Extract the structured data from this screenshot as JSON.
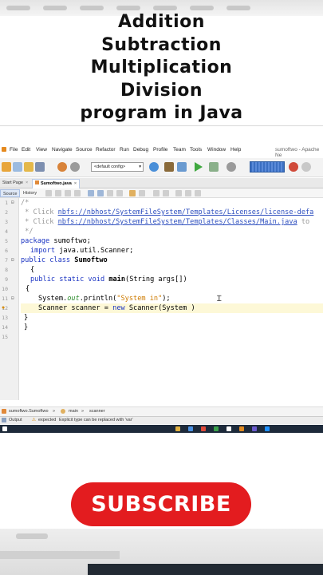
{
  "heading": {
    "lines": [
      "Addition",
      "Subtraction",
      "Multiplication",
      "Division",
      "program in Java"
    ]
  },
  "ide": {
    "window_title": "sumoftwo - Apache Ne",
    "menu": [
      "File",
      "Edit",
      "View",
      "Navigate",
      "Source",
      "Refactor",
      "Run",
      "Debug",
      "Profile",
      "Team",
      "Tools",
      "Window",
      "Help"
    ],
    "config_select": "<default config>",
    "tabs": {
      "start_page": "Start Page",
      "file": "Sumoftwo.java"
    },
    "editor_tabs": {
      "source": "Source",
      "history": "History"
    },
    "line_numbers": [
      "1",
      "2",
      "3",
      "4",
      "5",
      "6",
      "7",
      "8",
      "9",
      "10",
      "11",
      "12",
      "13",
      "14",
      "15"
    ],
    "code": {
      "l1": "/*",
      "l2_prefix": " * Click ",
      "l2_link": "nbfs://nbhost/SystemFileSystem/Templates/Licenses/license-defa",
      "l3_prefix": " * Click ",
      "l3_link": "nbfs://nbhost/SystemFileSystem/Templates/Classes/Main.java",
      "l3_suffix": " to",
      "l4": " */",
      "l5_kw": "package",
      "l5_rest": " sumoftwo;",
      "l6_kw": "import",
      "l6_rest": " java.util.Scanner;",
      "l7_kw": "public class",
      "l7_name": "Sumoftwo",
      "l8": "{",
      "l9_kw": "public static void",
      "l9_name": "main",
      "l9_rest": "(String args[])",
      "l10": "{",
      "l11_a": "System.",
      "l11_field": "out",
      "l11_b": ".println(",
      "l11_str": "\"System in\"",
      "l11_c": ");",
      "l12_a": "Scanner scanner = ",
      "l12_kw": "new",
      "l12_b": " Scanner(System )",
      "l13": "}",
      "l14": "}"
    },
    "breadcrumb": [
      "sumoftwo.Sumoftwo",
      "main",
      "scanner"
    ],
    "output": {
      "label": "Output",
      "message_prefix": "expected",
      "message": "Explicit type can be replaced with 'var'"
    }
  },
  "subscribe": {
    "label": "SUBSCRIBE",
    "color": "#e31c1f"
  }
}
